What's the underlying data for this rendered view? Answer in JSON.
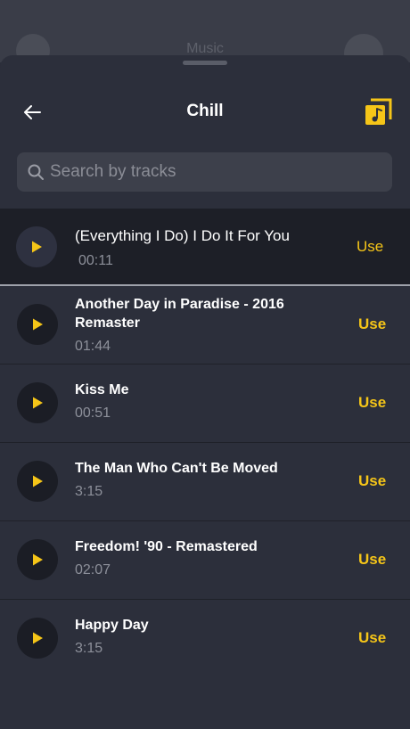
{
  "background": {
    "title": "Music"
  },
  "header": {
    "title": "Chill"
  },
  "search": {
    "placeholder": "Search by tracks",
    "value": ""
  },
  "tracks": [
    {
      "name": "(Everything I Do) I Do It For You",
      "duration": "00:11",
      "action": "Use",
      "playing": true
    },
    {
      "name": "Another Day in Paradise - 2016 Remaster",
      "duration": "01:44",
      "action": "Use",
      "playing": false
    },
    {
      "name": "Kiss Me",
      "duration": "00:51",
      "action": "Use",
      "playing": false
    },
    {
      "name": "The Man Who Can't Be Moved",
      "duration": "3:15",
      "action": "Use",
      "playing": false
    },
    {
      "name": "Freedom! '90 - Remastered",
      "duration": "02:07",
      "action": "Use",
      "playing": false
    },
    {
      "name": "Happy Day",
      "duration": "3:15",
      "action": "Use",
      "playing": false
    }
  ],
  "icons": {
    "back": "arrow-left-icon",
    "music": "music-note-icon",
    "search": "search-icon",
    "play": "play-icon"
  },
  "colors": {
    "accent": "#f5c518",
    "sheet": "#2c2f3b",
    "playing_row": "#1d1f27"
  }
}
